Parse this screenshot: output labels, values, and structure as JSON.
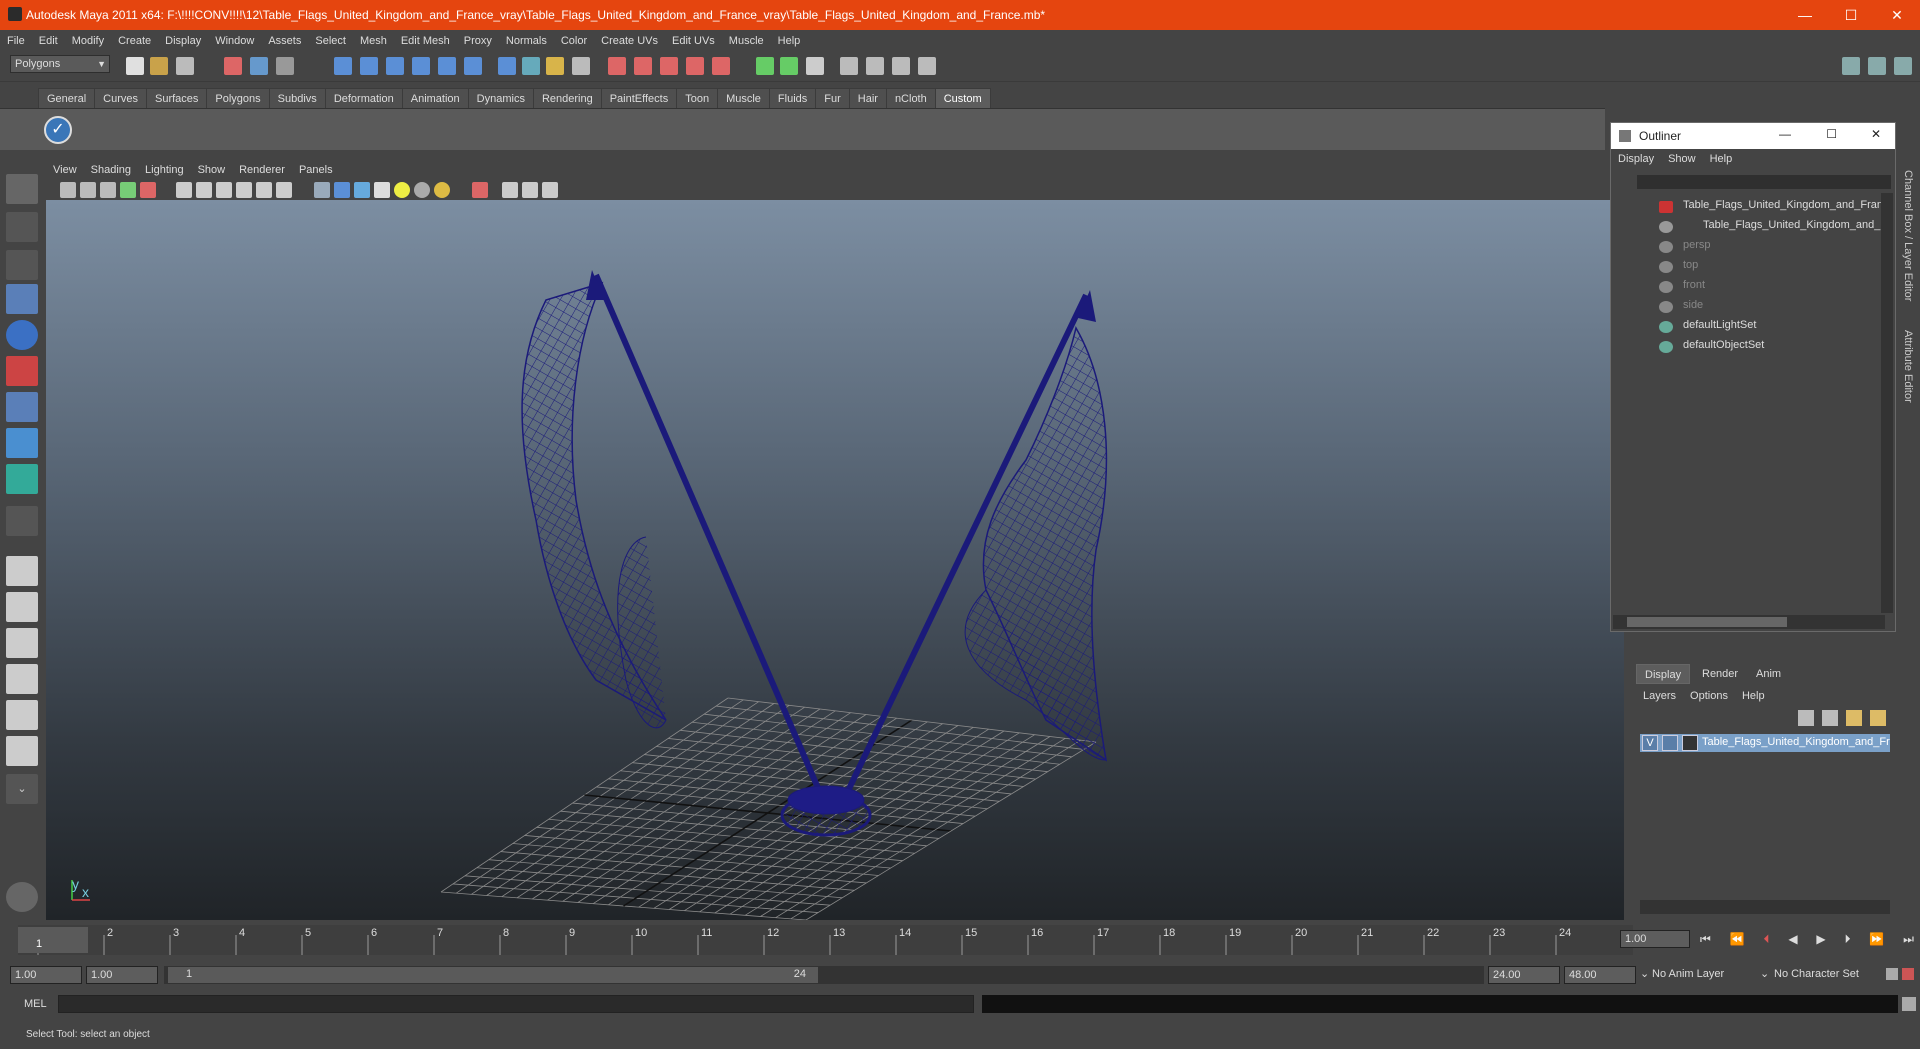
{
  "window": {
    "title": "Autodesk Maya 2011 x64: F:\\!!!!CONV!!!!\\12\\Table_Flags_United_Kingdom_and_France_vray\\Table_Flags_United_Kingdom_and_France_vray\\Table_Flags_United_Kingdom_and_France.mb*",
    "controls": {
      "minimize": "—",
      "maximize": "☐",
      "close": "✕"
    }
  },
  "menubar": [
    "File",
    "Edit",
    "Modify",
    "Create",
    "Display",
    "Window",
    "Assets",
    "Select",
    "Mesh",
    "Edit Mesh",
    "Proxy",
    "Normals",
    "Color",
    "Create UVs",
    "Edit UVs",
    "Muscle",
    "Help"
  ],
  "mode_selector": {
    "value": "Polygons"
  },
  "shelf_tabs": [
    "General",
    "Curves",
    "Surfaces",
    "Polygons",
    "Subdivs",
    "Deformation",
    "Animation",
    "Dynamics",
    "Rendering",
    "PaintEffects",
    "Toon",
    "Muscle",
    "Fluids",
    "Fur",
    "Hair",
    "nCloth",
    "Custom"
  ],
  "active_shelf_tab": "Custom",
  "viewport": {
    "menu": [
      "View",
      "Shading",
      "Lighting",
      "Show",
      "Renderer",
      "Panels"
    ],
    "axis_label_y": "y",
    "axis_label_x": "x"
  },
  "outliner": {
    "title": "Outliner",
    "menu": [
      "Display",
      "Show",
      "Help"
    ],
    "items": [
      {
        "label": "Table_Flags_United_Kingdom_and_Fran",
        "dim": false
      },
      {
        "label": "Table_Flags_United_Kingdom_and_I",
        "dim": false
      },
      {
        "label": "persp",
        "dim": true
      },
      {
        "label": "top",
        "dim": true
      },
      {
        "label": "front",
        "dim": true
      },
      {
        "label": "side",
        "dim": true
      },
      {
        "label": "defaultLightSet",
        "dim": false
      },
      {
        "label": "defaultObjectSet",
        "dim": false
      }
    ]
  },
  "layer_editor": {
    "tabs": [
      "Display",
      "Render",
      "Anim"
    ],
    "active_tab": "Display",
    "menu": [
      "Layers",
      "Options",
      "Help"
    ],
    "layer": {
      "visibility": "V",
      "name": "Table_Flags_United_Kingdom_and_Fr"
    }
  },
  "side_tabs": {
    "channel_box": "Channel Box / Layer Editor",
    "attribute_editor": "Attribute Editor"
  },
  "timeline": {
    "ticks": [
      "1",
      "2",
      "3",
      "4",
      "5",
      "6",
      "7",
      "8",
      "9",
      "10",
      "11",
      "12",
      "13",
      "14",
      "15",
      "16",
      "17",
      "18",
      "19",
      "20",
      "21",
      "22",
      "23",
      "24"
    ],
    "current_frame": "1",
    "current_time_field": "1.00"
  },
  "range": {
    "start_time": "1.00",
    "playback_start": "1.00",
    "range_start": "1",
    "range_end": "24",
    "playback_end": "24.00",
    "end_time": "48.00",
    "anim_layer": "No Anim Layer",
    "character_set": "No Character Set"
  },
  "command_line": {
    "label": "MEL"
  },
  "help_line": {
    "text": "Select Tool: select an object"
  }
}
